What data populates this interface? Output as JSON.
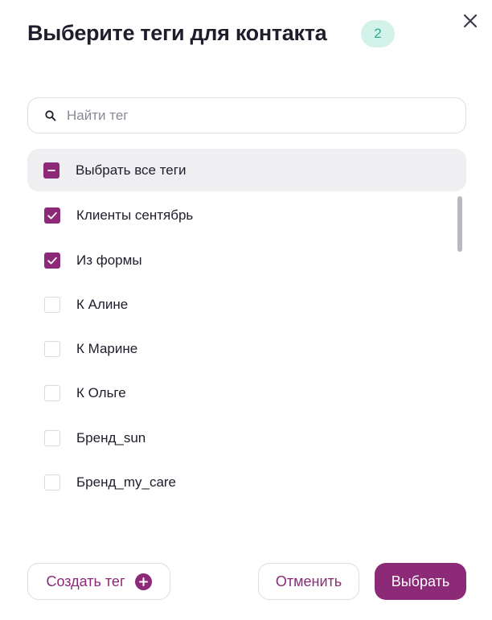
{
  "header": {
    "title": "Выберите теги для контакта",
    "selected_count": "2",
    "close_icon": "close-icon"
  },
  "search": {
    "placeholder": "Найти тег",
    "value": "",
    "icon": "search-icon"
  },
  "select_all": {
    "label": "Выбрать все теги",
    "state": "partial"
  },
  "tags": [
    {
      "label": "Клиенты сентябрь",
      "checked": true
    },
    {
      "label": "Из формы",
      "checked": true
    },
    {
      "label": "К Алине",
      "checked": false
    },
    {
      "label": "К Марине",
      "checked": false
    },
    {
      "label": "К Ольге",
      "checked": false
    },
    {
      "label": "Бренд_sun",
      "checked": false
    },
    {
      "label": "Бренд_my_care",
      "checked": false
    }
  ],
  "footer": {
    "create_label": "Создать тег",
    "create_icon": "plus-circle-icon",
    "cancel_label": "Отменить",
    "submit_label": "Выбрать"
  },
  "colors": {
    "accent": "#8c2a78",
    "badge_bg": "#d3f3ea",
    "badge_text": "#2aaa86",
    "row_highlight": "#efeff1"
  }
}
